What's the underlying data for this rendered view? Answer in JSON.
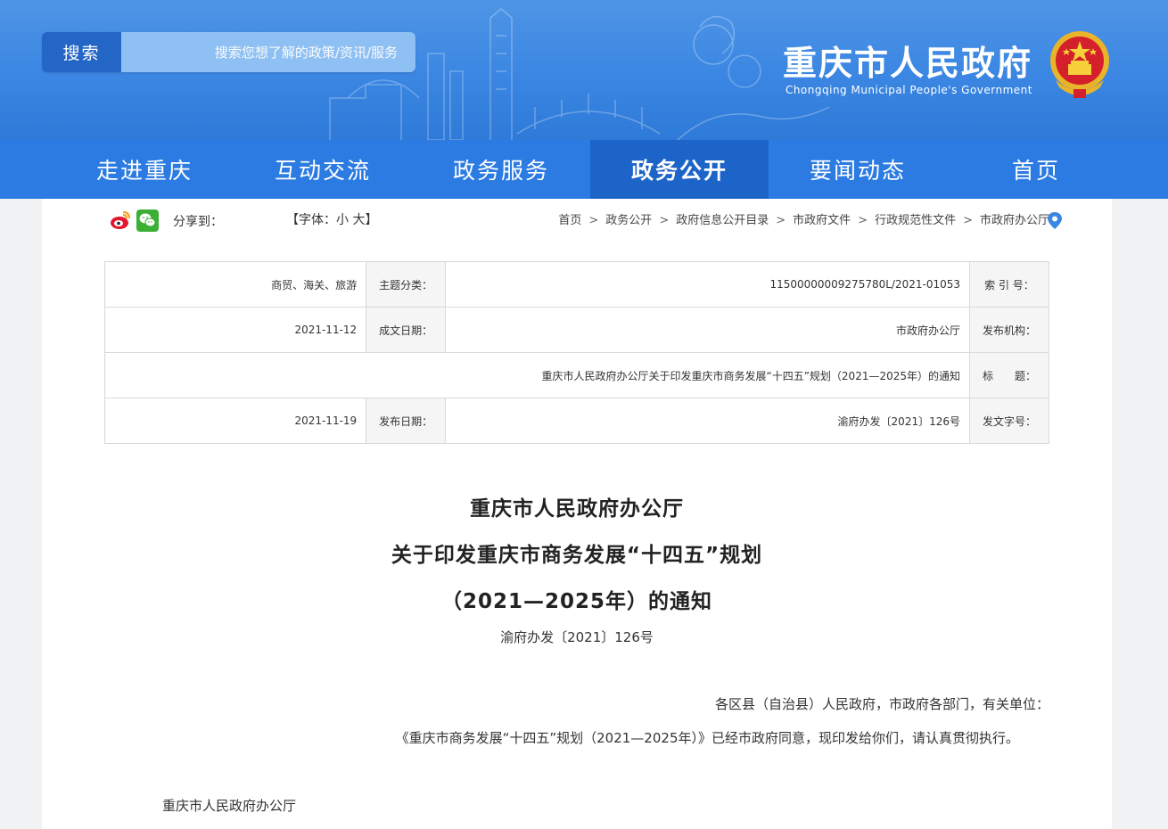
{
  "header": {
    "site_title": "重庆市人民政府",
    "site_subtitle": "Chongqing Municipal People's Government",
    "search_button": "搜索",
    "search_placeholder": "搜索您想了解的政策/资讯/服务"
  },
  "nav": {
    "items": [
      {
        "label": "首页",
        "active": false
      },
      {
        "label": "要闻动态",
        "active": false
      },
      {
        "label": "政务公开",
        "active": true
      },
      {
        "label": "政务服务",
        "active": false
      },
      {
        "label": "互动交流",
        "active": false
      },
      {
        "label": "走进重庆",
        "active": false
      }
    ]
  },
  "toolbar": {
    "share_label": "分享到：",
    "font_prefix": "【字体：",
    "font_small": "小",
    "font_large": "大",
    "font_suffix": "】"
  },
  "breadcrumb": [
    "首页",
    "政务公开",
    "政府信息公开目录",
    "市政府文件",
    "行政规范性文件",
    "市政府办公厅"
  ],
  "info": {
    "index_label": "索 引 号：",
    "index_value": "11500000009275780L/2021-01053",
    "topic_label": "主题分类：",
    "topic_value": "商贸、海关、旅游",
    "issuer_label": "发布机构：",
    "issuer_value": "市政府办公厅",
    "date_written_label": "成文日期：",
    "date_written_value": "2021-11-12",
    "title_label": "标　　题：",
    "title_value": "重庆市人民政府办公厅关于印发重庆市商务发展“十四五”规划（2021—2025年）的通知",
    "doc_no_label": "发文字号：",
    "doc_no_value": "渝府办发〔2021〕126号",
    "date_pub_label": "发布日期：",
    "date_pub_value": "2021-11-19"
  },
  "document": {
    "title_line1": "重庆市人民政府办公厅",
    "title_line2": "关于印发重庆市商务发展“十四五”规划",
    "title_line3": "（2021—2025年）的通知",
    "doc_number": "渝府办发〔2021〕126号",
    "addressee": "各区县（自治县）人民政府，市政府各部门，有关单位：",
    "body": "《重庆市商务发展“十四五”规划（2021—2025年）》已经市政府同意，现印发给你们，请认真贯彻执行。",
    "signature": "重庆市人民政府办公厅"
  },
  "colors": {
    "header_blue": "#3a86e2",
    "nav_blue": "#2b7be2",
    "nav_active": "#1c64c8",
    "search_btn": "#2466c6"
  }
}
